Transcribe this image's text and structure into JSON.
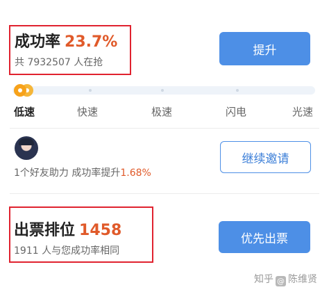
{
  "success": {
    "label": "成功率",
    "value": "23.7%",
    "sub": "共 7932507 人在抢"
  },
  "upgrade_button": "提升",
  "speeds": [
    "低速",
    "快速",
    "极速",
    "闪电",
    "光速"
  ],
  "speed_level": 0,
  "friend": {
    "help_text": "1个好友助力 成功率提升",
    "help_pct": "1.68%",
    "continue_button": "继续邀请"
  },
  "rank": {
    "label": "出票排位",
    "value": "1458",
    "sub": "1911 人与您成功率相同"
  },
  "priority_button": "优先出票",
  "watermark": {
    "prefix": "知乎",
    "at": "@",
    "name": "陈维贤"
  },
  "colors": {
    "accent": "#4d8fe6",
    "highlight": "#e05a2a",
    "annotation_box": "#e0222f",
    "slider": "#f7a21b"
  }
}
